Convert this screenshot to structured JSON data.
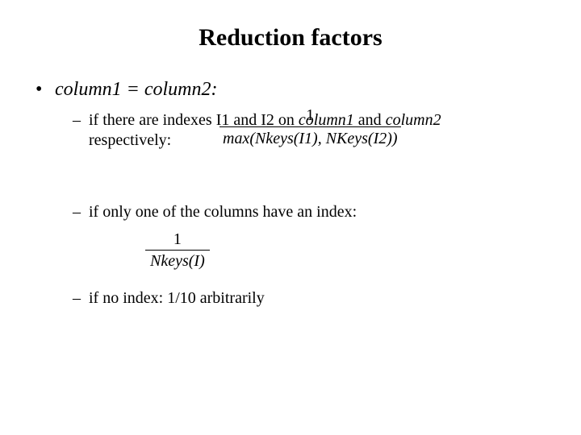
{
  "title": "Reduction factors",
  "bullet1": {
    "label": "column1 = column2:",
    "sub1": {
      "prefix": "if there are indexes I1 and I2 on ",
      "col1": "column1",
      "mid": " and ",
      "col2": "column2",
      "line2": "respectively:",
      "frac": {
        "num": "1",
        "den": "max(Nkeys(I1), NKeys(I2))"
      }
    },
    "sub2": {
      "text": "if only one of the columns have an index:",
      "frac": {
        "num": "1",
        "den": "Nkeys(I)"
      }
    },
    "sub3": {
      "text": "if no index: 1/10 arbitrarily"
    }
  }
}
